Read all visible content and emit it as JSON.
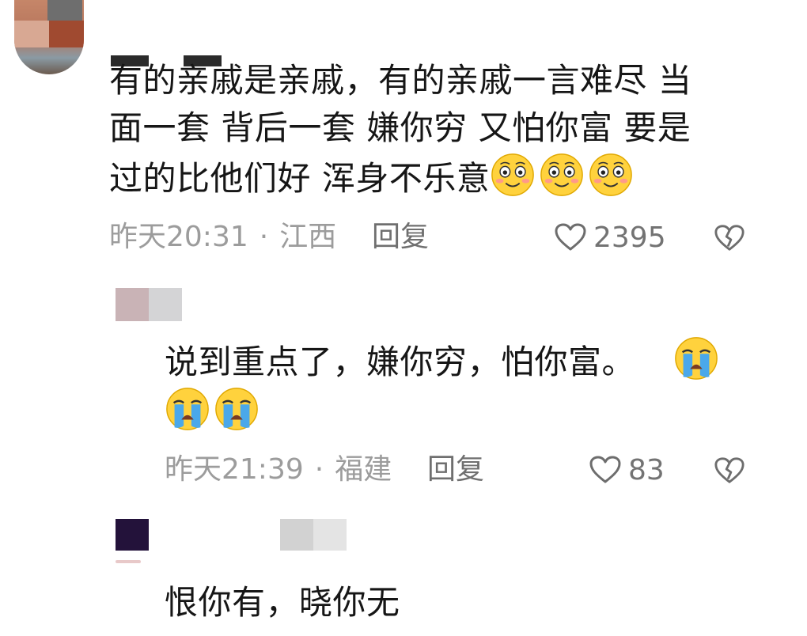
{
  "comments": [
    {
      "text_lines": [
        "有的亲戚是亲戚，有的亲戚一言难尽  当",
        "面一套 背后一套  嫌你穷  又怕你富  要是",
        "过的比他们好  浑身不乐意"
      ],
      "emoji_icon": "blushing-smile-icon",
      "time": "昨天20:31",
      "separator": "·",
      "location": "江西",
      "reply_label": "回复",
      "likes": "2395"
    },
    {
      "text_lines": [
        "说到重点了，嫌你穷，怕你富。"
      ],
      "emoji_icon": "loudly-crying-face-icon",
      "time": "昨天21:39",
      "separator": "·",
      "location": "福建",
      "reply_label": "回复",
      "likes": "83"
    },
    {
      "text_lines": [
        "恨你有，晓你无"
      ]
    }
  ],
  "icons": {
    "like": "heart-outline-icon",
    "dislike": "broken-heart-icon"
  },
  "colors": {
    "meta_text": "#9c9c9c",
    "emoji_yellow": "#ffd23d",
    "tear_blue": "#4aa8ea"
  }
}
